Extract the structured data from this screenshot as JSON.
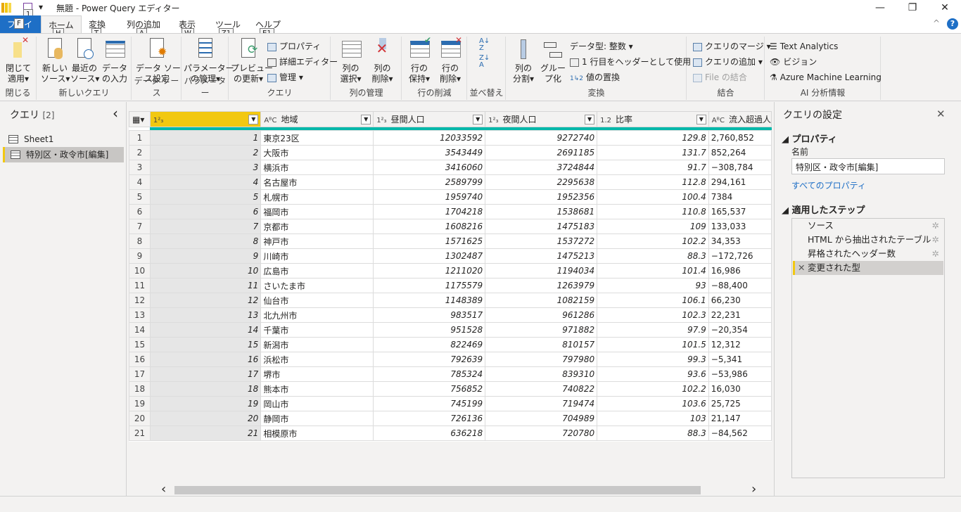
{
  "window": {
    "title": "無題 - Power Query エディター",
    "minimize": "—",
    "restore": "❐",
    "close": "✕",
    "collapse": "^",
    "help": "?"
  },
  "tabs": [
    {
      "label": "ファイル",
      "key": "F"
    },
    {
      "label": "ホーム",
      "key": "H"
    },
    {
      "label": "変換",
      "key": "T"
    },
    {
      "label": "列の追加",
      "key": "A"
    },
    {
      "label": "表示",
      "key": "W"
    },
    {
      "label": "ツール",
      "key": "Z1"
    },
    {
      "label": "ヘルプ",
      "key": "E1"
    }
  ],
  "qat_key": "1",
  "ribbon": {
    "close": {
      "group": "閉じる",
      "apply": "閉じて\n適用▾"
    },
    "newquery": {
      "group": "新しいクエリ",
      "new_source": "新しい\nソース▾",
      "recent": "最近の\nソース▾",
      "enter": "データ\nの入力"
    },
    "datasource": {
      "group": "データ ソース",
      "settings": "データ ソー\nス設定"
    },
    "params": {
      "group": "パラメーター",
      "manage": "パラメーター\nの管理▾"
    },
    "query": {
      "group": "クエリ",
      "refresh": "プレビュー\nの更新▾",
      "properties": "プロパティ",
      "advanced": "詳細エディター",
      "manage": "管理 ▾"
    },
    "columns": {
      "group": "列の管理",
      "choose": "列の\n選択▾",
      "remove": "列の\n削除▾"
    },
    "rows": {
      "group": "行の削減",
      "keep": "行の\n保持▾",
      "remove": "行の\n削除▾"
    },
    "sort": {
      "group": "並べ替え"
    },
    "transform": {
      "group": "変換",
      "split": "列の\n分割▾",
      "group_by": "グルー\nプ化",
      "datatype": "データ型: 整数 ▾",
      "first_row": "1 行目をヘッダーとして使用 ▾",
      "replace": "値の置換"
    },
    "combine": {
      "group": "結合",
      "merge": "クエリのマージ ▾",
      "append": "クエリの追加 ▾",
      "combine_files": "File の結合"
    },
    "ai": {
      "group": "AI 分析情報",
      "text": "Text Analytics",
      "vision": "ビジョン",
      "aml": "Azure Machine Learning"
    }
  },
  "queries": {
    "title": "クエリ",
    "count": "[2]",
    "collapse": "‹",
    "items": [
      "Sheet1",
      "特別区・政令市[編集]"
    ]
  },
  "table": {
    "columns": [
      {
        "type": "1²₃",
        "name": ""
      },
      {
        "type": "AᴮC",
        "name": "地域"
      },
      {
        "type": "1²₃",
        "name": "昼間人口"
      },
      {
        "type": "1²₃",
        "name": "夜間人口"
      },
      {
        "type": "1.2",
        "name": "比率"
      },
      {
        "type": "AᴮC",
        "name": "流入超過人"
      }
    ],
    "rows": [
      [
        "1",
        "東京23区",
        "12033592",
        "9272740",
        "129.8",
        "2,760,852"
      ],
      [
        "2",
        "大阪市",
        "3543449",
        "2691185",
        "131.7",
        "852,264"
      ],
      [
        "3",
        "横浜市",
        "3416060",
        "3724844",
        "91.7",
        "−308,784"
      ],
      [
        "4",
        "名古屋市",
        "2589799",
        "2295638",
        "112.8",
        "294,161"
      ],
      [
        "5",
        "札幌市",
        "1959740",
        "1952356",
        "100.4",
        "7384"
      ],
      [
        "6",
        "福岡市",
        "1704218",
        "1538681",
        "110.8",
        "165,537"
      ],
      [
        "7",
        "京都市",
        "1608216",
        "1475183",
        "109",
        "133,033"
      ],
      [
        "8",
        "神戸市",
        "1571625",
        "1537272",
        "102.2",
        "34,353"
      ],
      [
        "9",
        "川崎市",
        "1302487",
        "1475213",
        "88.3",
        "−172,726"
      ],
      [
        "10",
        "広島市",
        "1211020",
        "1194034",
        "101.4",
        "16,986"
      ],
      [
        "11",
        "さいたま市",
        "1175579",
        "1263979",
        "93",
        "−88,400"
      ],
      [
        "12",
        "仙台市",
        "1148389",
        "1082159",
        "106.1",
        "66,230"
      ],
      [
        "13",
        "北九州市",
        "983517",
        "961286",
        "102.3",
        "22,231"
      ],
      [
        "14",
        "千葉市",
        "951528",
        "971882",
        "97.9",
        "−20,354"
      ],
      [
        "15",
        "新潟市",
        "822469",
        "810157",
        "101.5",
        "12,312"
      ],
      [
        "16",
        "浜松市",
        "792639",
        "797980",
        "99.3",
        "−5,341"
      ],
      [
        "17",
        "堺市",
        "785324",
        "839310",
        "93.6",
        "−53,986"
      ],
      [
        "18",
        "熊本市",
        "756852",
        "740822",
        "102.2",
        "16,030"
      ],
      [
        "19",
        "岡山市",
        "745199",
        "719474",
        "103.6",
        "25,725"
      ],
      [
        "20",
        "静岡市",
        "726136",
        "704989",
        "103",
        "21,147"
      ],
      [
        "21",
        "相模原市",
        "636218",
        "720780",
        "88.3",
        "−84,562"
      ]
    ]
  },
  "settings": {
    "title": "クエリの設定",
    "close": "✕",
    "properties": "プロパティ",
    "name_label": "名前",
    "name_value": "特別区・政令市[編集]",
    "all_props": "すべてのプロパティ",
    "steps_title": "適用したステップ",
    "steps": [
      "ソース",
      "HTML から抽出されたテーブル",
      "昇格されたヘッダー数",
      "変更された型"
    ]
  },
  "scroll": {
    "left": "‹",
    "right": "›"
  },
  "colors": {
    "accent": "#f2c811",
    "file_tab": "#1e6fc6",
    "teal": "#01b8aa",
    "link": "#1e6fc6"
  }
}
